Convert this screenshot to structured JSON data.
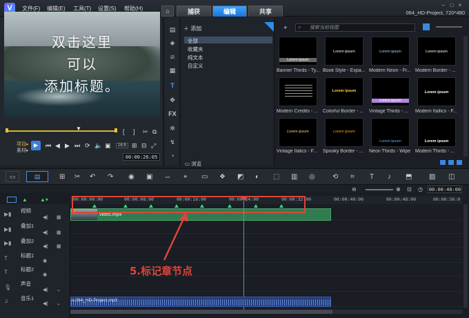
{
  "app": {
    "menu": [
      "文件(F)",
      "编辑(E)",
      "工具(T)",
      "设置(S)",
      "帮助(H)"
    ],
    "tabs": [
      "捕获",
      "编辑",
      "共享"
    ],
    "active_tab": "编辑",
    "project_info": "064_HD-Project, 720*480"
  },
  "preview": {
    "overlay_lines": [
      "双击这里",
      "可以",
      "添加标题。"
    ],
    "mode_project": "项目▸",
    "mode_clip": "素材▸",
    "timecode": "00:00:26:05",
    "zoom_value": "16:9"
  },
  "library": {
    "add_label": "添加",
    "tree_items": [
      "全部",
      "收藏夹",
      "纯文本",
      "自定义"
    ],
    "selected_item": "全部",
    "browse_label": "浏览",
    "search_placeholder": "搜索当前视图",
    "thumbnails": [
      {
        "caption": "Banner Thirds - Ty...",
        "text": "Lorem ipsum"
      },
      {
        "caption": "Book Style - Expa...",
        "text": "Lorem ipsum"
      },
      {
        "caption": "Modern Neon - Fr...",
        "text": "Lorem ipsum"
      },
      {
        "caption": "Modern Border - ...",
        "text": "Lorem ipsum"
      },
      {
        "caption": "Modern Credits - ...",
        "text": ""
      },
      {
        "caption": "Colorful Border - ...",
        "text": "Lorem ipsum"
      },
      {
        "caption": "Vintage Thirds - ...",
        "text": "Lorem ipsum"
      },
      {
        "caption": "Modern Itallics - F...",
        "text": "Lorem ipsum"
      },
      {
        "caption": "Vintage Italics - F...",
        "text": "Lorem ipsum"
      },
      {
        "caption": "Spooky Border - ...",
        "text": "Lorem ipsum"
      },
      {
        "caption": "Neon Thirds - Wipe",
        "text": "Lorem ipsum"
      },
      {
        "caption": "Modern Thirds - ...",
        "text": "Lorem ipsum"
      }
    ]
  },
  "timeline": {
    "timecode": "00:00:40:00",
    "ruler": [
      "00:00:00:00",
      "00:00:08:00",
      "00:00:16:00",
      "00:00:24:00",
      "00:00:32:00",
      "00:00:40:00",
      "00:00:48:00",
      "00:00:56:0"
    ],
    "tracks": [
      "视频",
      "叠加1",
      "叠加2",
      "标题1",
      "标题2",
      "声音",
      "音乐1"
    ],
    "video_clip": "video.mp4",
    "audio_clip": "o.064_HD-Project.mp3"
  },
  "annotation": {
    "label": "5.标记章节点",
    "color": "#e0443a"
  }
}
